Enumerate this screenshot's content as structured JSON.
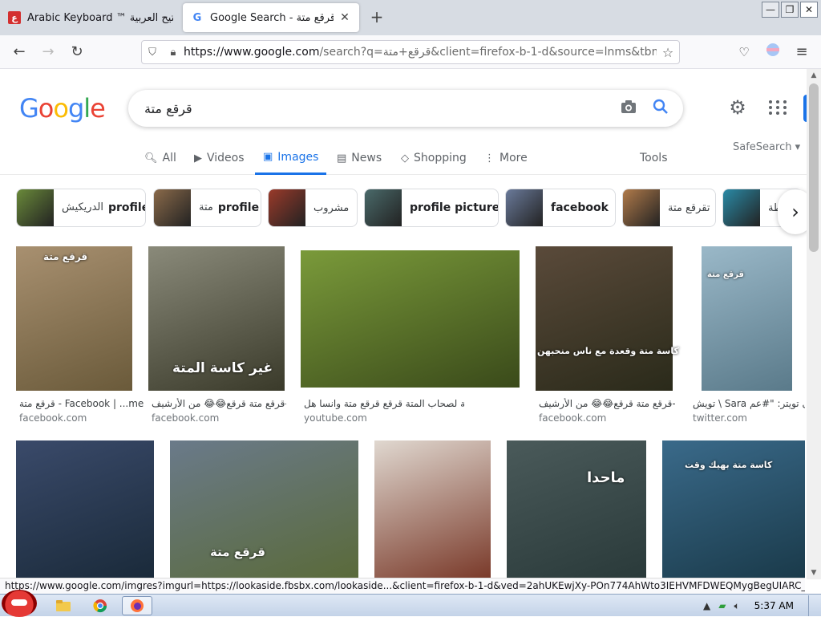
{
  "browser": {
    "tabs": [
      {
        "title": "Arabic Keyboard ™ لوحة المفاتيح العربية",
        "icon": "arabic-keyboard-favicon",
        "active": false
      },
      {
        "title": "Google Search - قرقع متة",
        "icon": "google-favicon",
        "active": true
      }
    ],
    "new_tab": "+",
    "url_domain": "https://www.google.com",
    "url_rest": "/search?q=قرقع+متة&client=firefox-b-1-d&source=lnms&tbm=i"
  },
  "google": {
    "logo": [
      "G",
      "o",
      "o",
      "g",
      "l",
      "e"
    ],
    "query": "قرقع متة",
    "tabs": [
      {
        "label": "All",
        "icon": "search-icon"
      },
      {
        "label": "Videos",
        "icon": "play-icon"
      },
      {
        "label": "Images",
        "icon": "image-icon"
      },
      {
        "label": "News",
        "icon": "news-icon"
      },
      {
        "label": "Shopping",
        "icon": "tag-icon"
      },
      {
        "label": "More",
        "icon": "more-vert-icon"
      }
    ],
    "tools": "Tools",
    "safesearch": "SafeSearch ▾",
    "chips": [
      {
        "strong": "profile",
        "ar": "الدريكيش",
        "color": "#6a8a3a"
      },
      {
        "strong": "profile",
        "ar": "متة",
        "color": "#8a6a4a"
      },
      {
        "strong": "",
        "ar": "مشروب",
        "color": "#9a3a2a"
      },
      {
        "strong": "profile picture",
        "ar": "",
        "color": "#4a6a6a"
      },
      {
        "strong": "facebook",
        "ar": "",
        "color": "#6a7a9a"
      },
      {
        "strong": "",
        "ar": "تقرقع متة",
        "color": "#b07a4a"
      },
      {
        "strong": "",
        "ar": "طة",
        "color": "#2a8aa6"
      }
    ]
  },
  "results": [
    {
      "title": "قرقع متة - Facebook | ...me",
      "source": "facebook.com",
      "overlay": "قرقع متة",
      "colors": [
        "#a89070",
        "#6a5a3a"
      ]
    },
    {
      "title": "قرقع متة قرقع😂😂 من الأرشيف- #...",
      "source": "facebook.com",
      "overlay": "غير كاسة المتة",
      "colors": [
        "#8a8a7a",
        "#3a3a2a"
      ]
    },
    {
      "title": "تحية لصحاب المتة قرقع قرقع متة وانسا هل ...",
      "source": "youtube.com",
      "overlay": "",
      "colors": [
        "#7a9a3a",
        "#3a4a1a"
      ]
    },
    {
      "title": "قرقع متة قرقع😂😂 من الأرشيف- #H...",
      "source": "facebook.com",
      "overlay": "كاسة متة وقعدة مع ناس منحبهن",
      "colors": [
        "#5a4a3a",
        "#2a2a1a"
      ]
    },
    {
      "title": "تويش \\ Sara على تويتر: \"#عم...",
      "source": "twitter.com",
      "overlay": "قرقع متة",
      "colors": [
        "#9ab8c8",
        "#5a7a8a"
      ]
    },
    {
      "title": "",
      "source": "",
      "overlay": "",
      "colors": [
        "#3a4a6a",
        "#1a2a3a"
      ]
    },
    {
      "title": "",
      "source": "",
      "overlay": "قرقع متة",
      "colors": [
        "#6a7a8a",
        "#5a6a3a"
      ]
    },
    {
      "title": "",
      "source": "",
      "overlay": "",
      "colors": [
        "#e0d8d0",
        "#7a3a2a"
      ]
    },
    {
      "title": "",
      "source": "",
      "overlay": "ماحدا",
      "colors": [
        "#4a5a5a",
        "#2a3a3a"
      ]
    },
    {
      "title": "",
      "source": "",
      "overlay": "كاسة متة بهيك وقت",
      "colors": [
        "#3a6a8a",
        "#1a3a4a"
      ]
    }
  ],
  "status_url": "https://www.google.com/imgres?imgurl=https://lookaside.fbsbx.com/lookaside...&client=firefox-b-1-d&ved=2ahUKEwjXy-POn774AhWto3IEHVMFDWEQMygBegUIARC_AQ",
  "taskbar": {
    "clock": "5:37 AM"
  }
}
